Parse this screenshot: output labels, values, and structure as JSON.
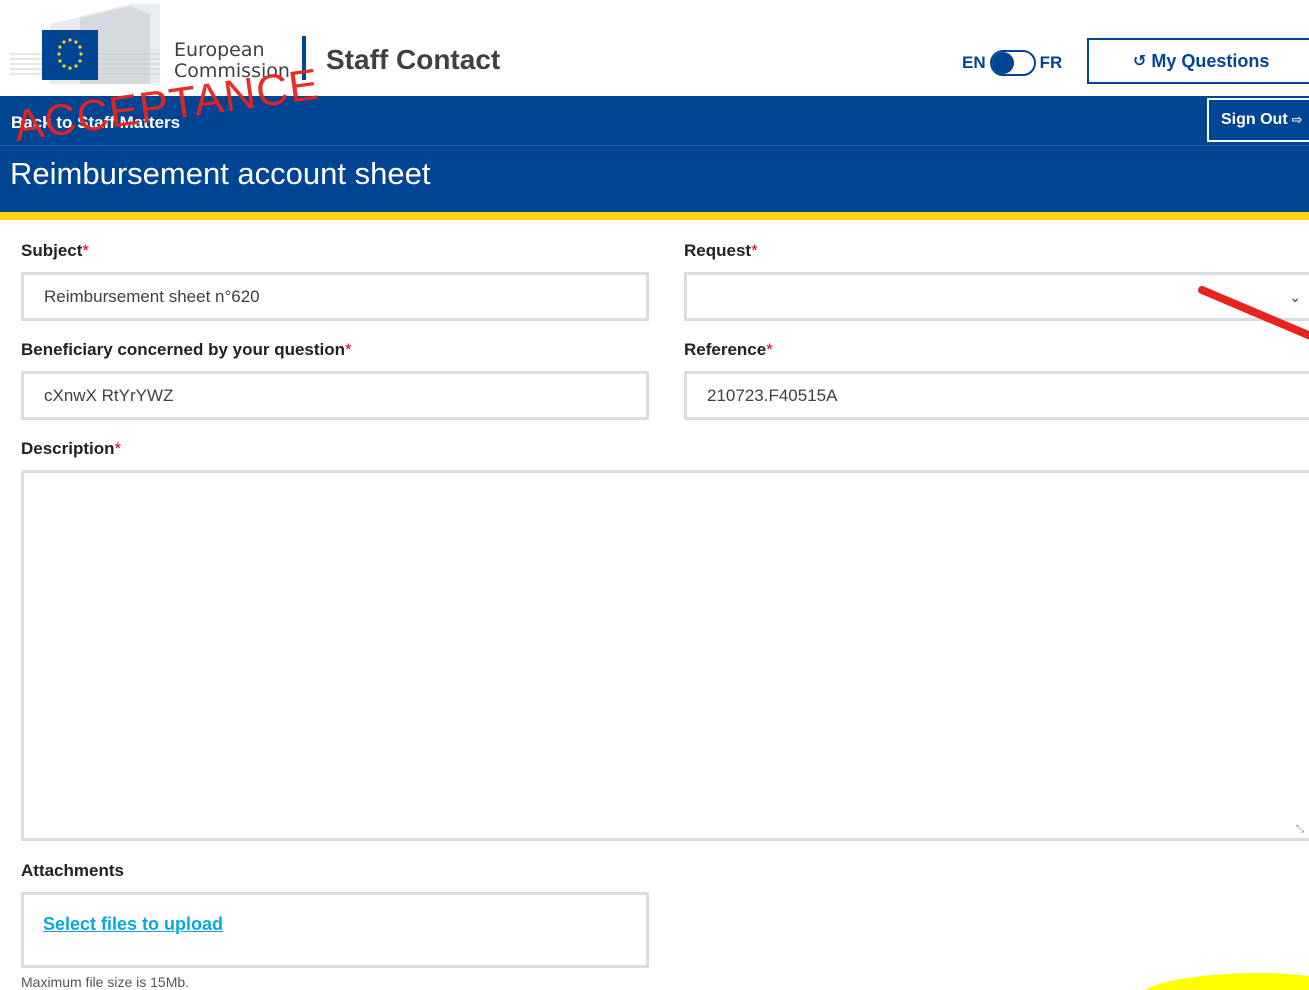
{
  "header": {
    "logo_line1": "European",
    "logo_line2": "Commission",
    "site_title": "Staff Contact",
    "lang_left": "EN",
    "lang_right": "FR",
    "my_questions": "My Questions"
  },
  "banner": {
    "back_link": "Back to Staff Matters",
    "sign_out": "Sign Out",
    "watermark": "ACCEPTANCE",
    "page_title": "Reimbursement account sheet"
  },
  "form": {
    "subject_label": "Subject",
    "subject_value": "Reimbursement sheet n°620",
    "request_label": "Request",
    "request_value": "",
    "beneficiary_label": "Beneficiary concerned by your question",
    "beneficiary_value": "cXnwX RtYrYWZ",
    "reference_label": "Reference",
    "reference_value": "210723.F40515A",
    "description_label": "Description",
    "description_value": "",
    "attachments_label": "Attachments",
    "upload_link": "Select files to upload",
    "max_size_hint": "Maximum file size is 15Mb.",
    "required_mark": "*"
  },
  "colors": {
    "brand_blue": "#004494",
    "accent_yellow": "#ffd617",
    "link_blue": "#0aa6e0",
    "required_red": "#d0021b"
  },
  "icons": {
    "my_questions": "history-icon",
    "sign_out": "sign-out-icon",
    "select": "chevron-down-icon"
  }
}
